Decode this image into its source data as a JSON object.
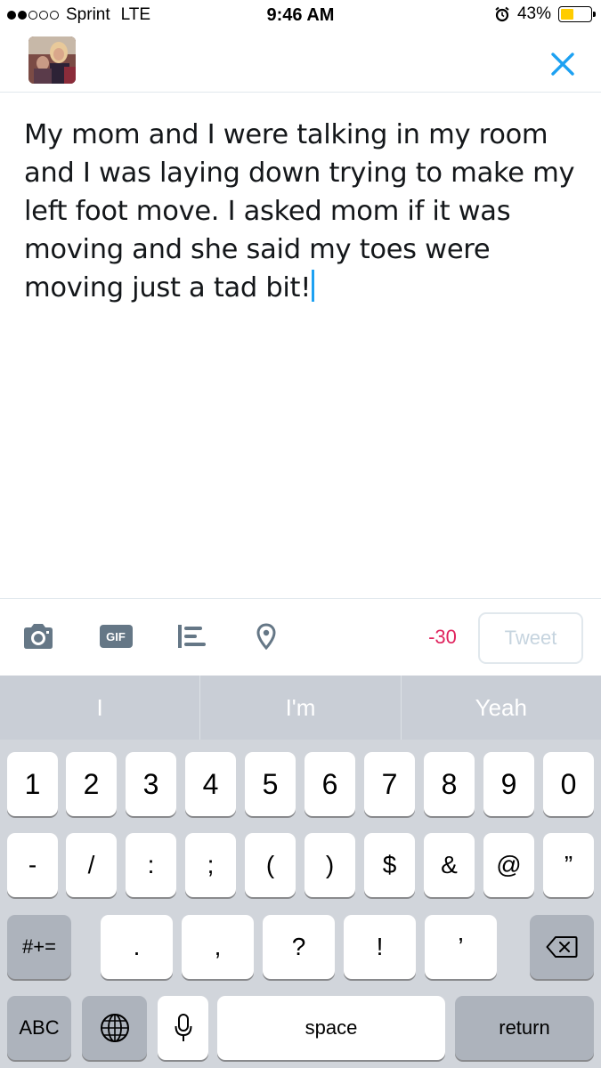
{
  "status_bar": {
    "carrier": "Sprint",
    "network": "LTE",
    "time": "9:46 AM",
    "battery_percent": "43%",
    "battery_level": 0.43,
    "signal_bars_filled": 2,
    "signal_bars_total": 5
  },
  "header": {
    "avatar_icon": "profile-photo",
    "close_icon": "close-x-icon"
  },
  "compose": {
    "text": "My mom and I were talking in my room and I was laying down trying to make my left foot move. I asked mom if it was moving and she said my toes were moving just a tad bit!"
  },
  "toolbar": {
    "gif_label": "GIF",
    "char_counter": "-30",
    "tweet_label": "Tweet",
    "counter_color": "#e0245e",
    "icon_color": "#657786"
  },
  "keyboard": {
    "suggestions": [
      "I",
      "I'm",
      "Yeah"
    ],
    "row1": [
      "1",
      "2",
      "3",
      "4",
      "5",
      "6",
      "7",
      "8",
      "9",
      "0"
    ],
    "row2": [
      "-",
      "/",
      ":",
      ";",
      "(",
      ")",
      "$",
      "&",
      "@",
      "”"
    ],
    "row3": [
      ".",
      ",",
      "?",
      "!",
      "’"
    ],
    "shift_label": "#+=",
    "abc_label": "ABC",
    "space_label": "space",
    "return_label": "return"
  },
  "colors": {
    "accent": "#1da1f2",
    "keyboard_bg": "#d1d5db",
    "function_key": "#adb3bc"
  }
}
